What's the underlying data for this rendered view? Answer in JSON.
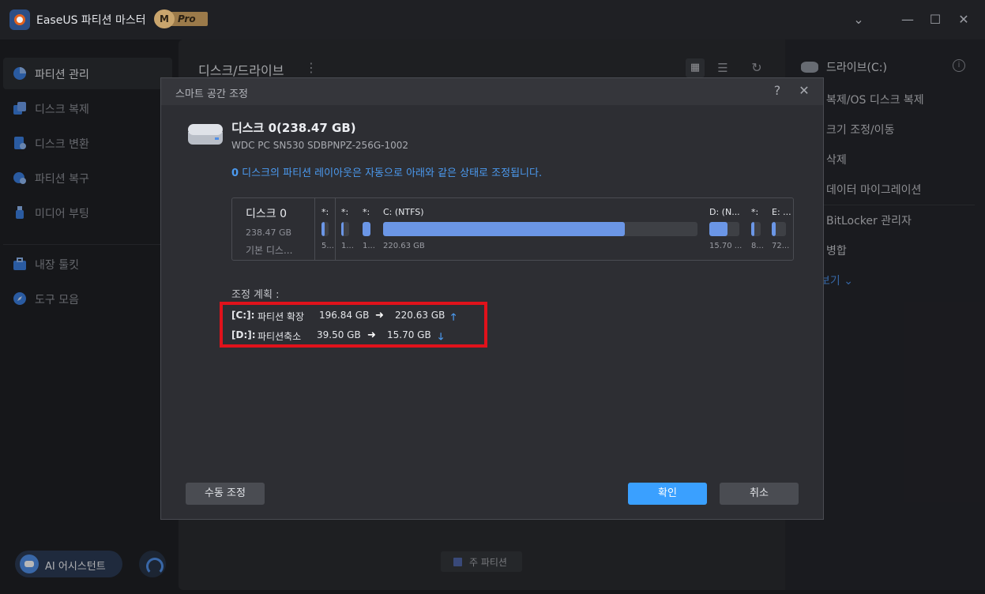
{
  "app": {
    "title": "EaseUS 파티션 마스터",
    "badge_m": "M",
    "badge_pro": "Pro"
  },
  "window_controls": {
    "menu": "⌄",
    "minimize": "—",
    "maximize": "☐",
    "close": "✕"
  },
  "sidebar": {
    "items": [
      {
        "label": "파티션 관리",
        "icon": "pie-chart-icon"
      },
      {
        "label": "디스크 복제",
        "icon": "copy-icon"
      },
      {
        "label": "디스크 변환",
        "icon": "convert-icon"
      },
      {
        "label": "파티션 복구",
        "icon": "recover-icon"
      },
      {
        "label": "미디어 부팅",
        "icon": "usb-icon"
      },
      {
        "label": "내장 툴킷",
        "icon": "toolbox-icon"
      },
      {
        "label": "도구 모음",
        "icon": "compass-icon"
      }
    ],
    "ai_assistant": "AI 어시스턴트"
  },
  "main": {
    "title": "디스크/드라이브",
    "legend_primary": "주 파티션"
  },
  "right_panel": {
    "title": "드라이브(C:)",
    "items": [
      "복제/OS 디스크 복제",
      "크기 조정/이동",
      "삭제",
      "데이터 마이그레이션",
      "BitLocker 관리자",
      "병합"
    ],
    "more": "보기 ⌄"
  },
  "dialog": {
    "title": "스마트 공간 조정",
    "disk_name": "디스크 0(238.47 GB)",
    "disk_model": "WDC PC SN530 SDBPNPZ-256G-1002",
    "note_num": "0",
    "note": " 디스크의 파티션 레이아웃은 자동으로 아래와 같은 상태로 조정됩니다.",
    "layout": {
      "disk_label": "디스크 0",
      "disk_size": "238.47 GB",
      "disk_type": "기본 디스...",
      "partitions": [
        {
          "label": "*:",
          "size": "5...",
          "used": 0.4
        },
        {
          "label": "*:",
          "size": "1...",
          "used": 0.3
        },
        {
          "label": "*:",
          "size": "1...",
          "used": 1.0
        },
        {
          "label": "C: (NTFS)",
          "size": "220.63 GB",
          "used": 0.77
        },
        {
          "label": "D: (N...",
          "size": "15.70 ...",
          "used": 0.6
        },
        {
          "label": "*:",
          "size": "8...",
          "used": 0.3
        },
        {
          "label": "E: ...",
          "size": "72...",
          "used": 0.3
        }
      ]
    },
    "plan_title": "조정 계획 :",
    "plan": [
      {
        "drive": "[C:]:",
        "action": "파티션 확장",
        "from": "196.84 GB",
        "arrow": "➜",
        "to": "220.63 GB",
        "dir": "🡑"
      },
      {
        "drive": "[D:]:",
        "action": "파티션축소",
        "from": "39.50 GB",
        "arrow": "➜",
        "to": "15.70 GB",
        "dir": "🡓"
      }
    ],
    "buttons": {
      "manual": "수동 조정",
      "ok": "확인",
      "cancel": "취소"
    }
  },
  "colors": {
    "accent": "#3aa0ff",
    "highlight": "#e0121b",
    "partition_fill": "#6b96e6"
  }
}
